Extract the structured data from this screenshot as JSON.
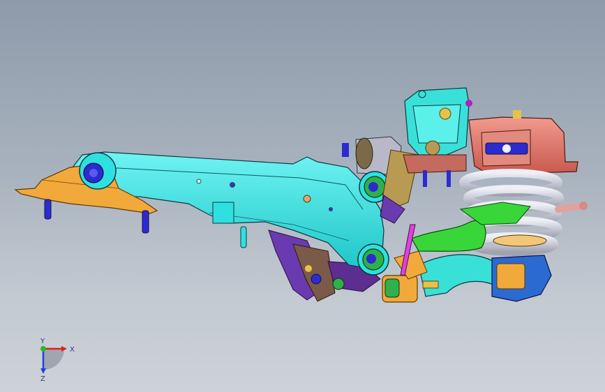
{
  "viewport": {
    "background_top": "#8e9aaa",
    "background_bottom": "#cdd2d8"
  },
  "model": {
    "colors": {
      "control_arm": "#2fe0e0",
      "bracket": "#f2a93b",
      "bushing": "#2fb04a",
      "bolt": "#2b2bd0",
      "spring": "#c7c9d3",
      "spring_mount": "#e07a6e",
      "stabilizer": "#39d639",
      "link": "#e040e0",
      "knuckle": "#7c5a4a",
      "bracket_purple": "#6a3ab0",
      "tube": "#39e0d8"
    }
  },
  "triad": {
    "x_label": "X",
    "y_label": "Y",
    "z_label": "Z",
    "x_color": "#e02020",
    "y_color": "#20c020",
    "z_color": "#2040e0"
  }
}
